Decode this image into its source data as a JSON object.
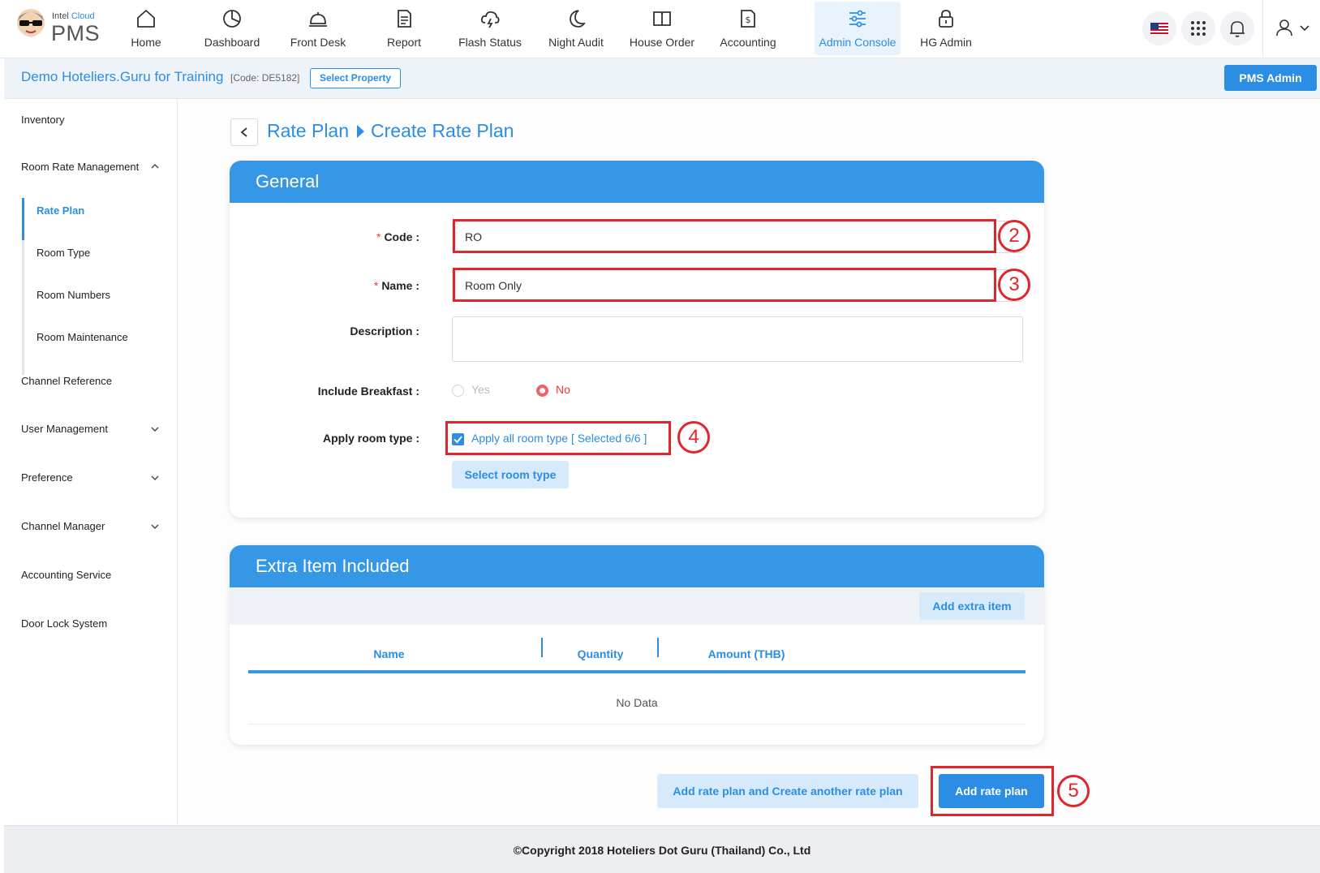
{
  "brand": {
    "top_prefix": "Intel ",
    "top_cloud": "Cloud",
    "main": "PMS"
  },
  "nav": {
    "items": [
      {
        "label": "Home",
        "icon": "home-icon"
      },
      {
        "label": "Dashboard",
        "icon": "pie-chart-icon"
      },
      {
        "label": "Front Desk",
        "icon": "bell-icon"
      },
      {
        "label": "Report",
        "icon": "document-icon"
      },
      {
        "label": "Flash Status",
        "icon": "cloud-lightning-icon"
      },
      {
        "label": "Night Audit",
        "icon": "moon-icon"
      },
      {
        "label": "House Order",
        "icon": "book-icon"
      },
      {
        "label": "Accounting",
        "icon": "money-file-icon"
      },
      {
        "label": "Admin Console",
        "icon": "sliders-icon",
        "active": true
      },
      {
        "label": "HG Admin",
        "icon": "lock-icon"
      }
    ],
    "accent_color": "#2b8de3"
  },
  "property": {
    "name": "Demo Hoteliers.Guru for Training",
    "code": "[Code: DE5182]",
    "select_label": "Select Property",
    "role_button": "PMS Admin"
  },
  "sidebar": {
    "items": [
      {
        "label": "Inventory"
      },
      {
        "label": "Room Rate Management",
        "expanded": true
      },
      {
        "label": "Channel Reference"
      },
      {
        "label": "User Management"
      },
      {
        "label": "Preference"
      },
      {
        "label": "Channel Manager"
      },
      {
        "label": "Accounting Service"
      },
      {
        "label": "Door Lock System"
      }
    ],
    "subitems": [
      {
        "label": "Rate Plan",
        "active": true
      },
      {
        "label": "Room Type"
      },
      {
        "label": "Room Numbers"
      },
      {
        "label": "Room Maintenance"
      }
    ]
  },
  "breadcrumb": {
    "parent": "Rate Plan",
    "current": "Create Rate Plan"
  },
  "general": {
    "title": "General",
    "code_label": "Code :",
    "code_value": "RO",
    "name_label": "Name :",
    "name_value": "Room Only",
    "description_label": "Description :",
    "description_value": "",
    "breakfast_label": "Include Breakfast :",
    "breakfast_yes": "Yes",
    "breakfast_no": "No",
    "breakfast_selected": "No",
    "room_type_label": "Apply room type :",
    "apply_all_label": "Apply all room type [ Selected 6/6 ]",
    "apply_all_checked": true,
    "select_room_type": "Select room type"
  },
  "extra": {
    "title": "Extra Item Included",
    "add_button": "Add extra item",
    "columns": [
      "Name",
      "Quantity",
      "Amount (THB)"
    ],
    "rows": [],
    "empty_text": "No Data"
  },
  "actions": {
    "add_and_create": "Add rate plan and Create another rate plan",
    "add": "Add rate plan"
  },
  "annotations": {
    "step2": "2",
    "step3": "3",
    "step4": "4",
    "step5": "5",
    "color": "#e0262c"
  },
  "footer": {
    "copyright": "©Copyright 2018 Hoteliers Dot Guru (Thailand) Co., Ltd"
  }
}
